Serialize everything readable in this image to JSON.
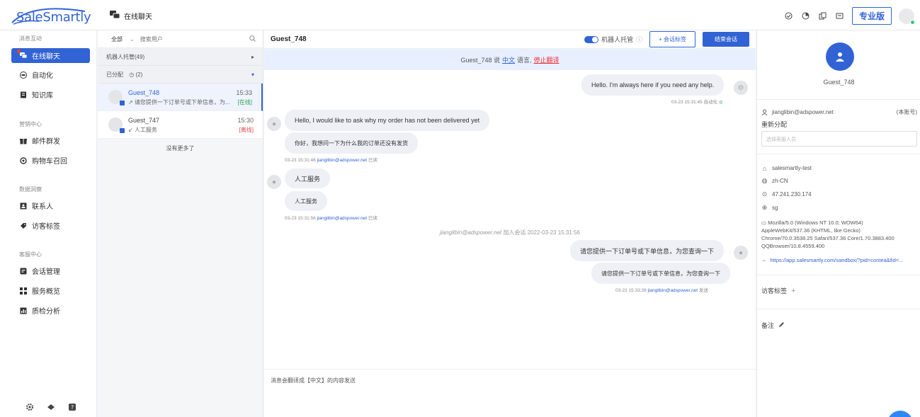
{
  "app": {
    "logo": "SaleSmartly",
    "page_title": "在线聊天",
    "plan_badge": "专业版"
  },
  "nav": {
    "groups": {
      "message": "消息互动",
      "marketing": "营销中心",
      "data": "数据洞察",
      "service": "客服中心"
    },
    "items": {
      "live_chat": "在线聊天",
      "automation": "自动化",
      "knowledge": "知识库",
      "email": "邮件群发",
      "cart_recovery": "购物车召回",
      "contacts": "联系人",
      "visitor_tags": "访客标签",
      "session_mgmt": "会话管理",
      "service_overview": "服务概览",
      "quality": "质检分析"
    }
  },
  "convlist": {
    "filter_value": "全部",
    "search_placeholder": "搜索用户",
    "robot_section": "机器人托管(49)",
    "assigned_section": "已分配",
    "assigned_count": "(2)",
    "items": [
      {
        "name": "Guest_748",
        "time": "15:33",
        "msg": "↗ 请您提供一下订单号或下单信息，为...",
        "status": "[在线]",
        "status_color": "#2ea44f"
      },
      {
        "name": "Guest_747",
        "time": "15:30",
        "msg": "↙ 人工服务",
        "status": "[离线]",
        "status_color": "#e5484d"
      }
    ],
    "no_more": "没有更多了"
  },
  "chat": {
    "title": "Guest_748",
    "robot_toggle_label": "机器人托管",
    "add_tag_button": "+ 会话标签",
    "end_button": "结束会话",
    "translate_prefix": "Guest_748 说",
    "translate_lang": "中文",
    "translate_suffix": "语言,",
    "translate_stop": "停止翻译",
    "messages": {
      "m1_text": "Hello. I'm always here if you need any help.",
      "m1_meta": "03-23 15:31:45 自动化",
      "m2_text": "Hello, I would like to ask why my order has not been delivered yet",
      "m2_trans": "你好，我想问一下为什么我的订单还没有发货",
      "m2_time": "03-23 15:31:46",
      "m2_email": "jianglibin@adspower.net",
      "m2_read": "已读",
      "m3_text": "人工服务",
      "m3_trans": "人工服务",
      "m3_time": "03-23 15:31:56",
      "m3_email": "jianglibin@adspower.net",
      "m3_read": "已读",
      "sys_email": "jianglibin@adspower.net",
      "sys_text": "加入会话 2022-03-23 15:31:56",
      "m4_text": "请您提供一下订单号或下单信息，为您查询一下",
      "m4_trans": "请您提供一下订单号或下单信息，为您查询一下",
      "m4_time": "03-23 15:33:39",
      "m4_email": "jianglibin@adspower.net",
      "m4_sent": "发送"
    },
    "input_hint": "消息会翻译成【中文】的内容发送"
  },
  "profile": {
    "name": "Guest_748",
    "assignee": "jianglibin@adspower.net",
    "assignee_note": "(本账号)",
    "reassign_label": "重新分配",
    "reassign_placeholder": "选择客服人员",
    "site": "salesmartly-test",
    "lang": "zh-CN",
    "ip": "47.241.230.174",
    "region": "sg",
    "ua_line1": "Mozilla/5.0 (Windows NT 10.0; WOW64)",
    "ua_line2": "AppleWebKit/537.36 (KHTML, like Gecko)",
    "ua_line3": "Chrome/70.0.3538.25 Safari/537.36 Core/1.70.3883.400",
    "ua_line4": "QQBrowser/10.8.4559.400",
    "url": "https://app.salesmartly.com/sandbox/?pid=contea&fid=...",
    "visitor_tags_label": "访客标签",
    "notes_label": "备注"
  },
  "colors": {
    "primary": "#3163d4",
    "online": "#2ea44f",
    "offline": "#e5484d"
  }
}
